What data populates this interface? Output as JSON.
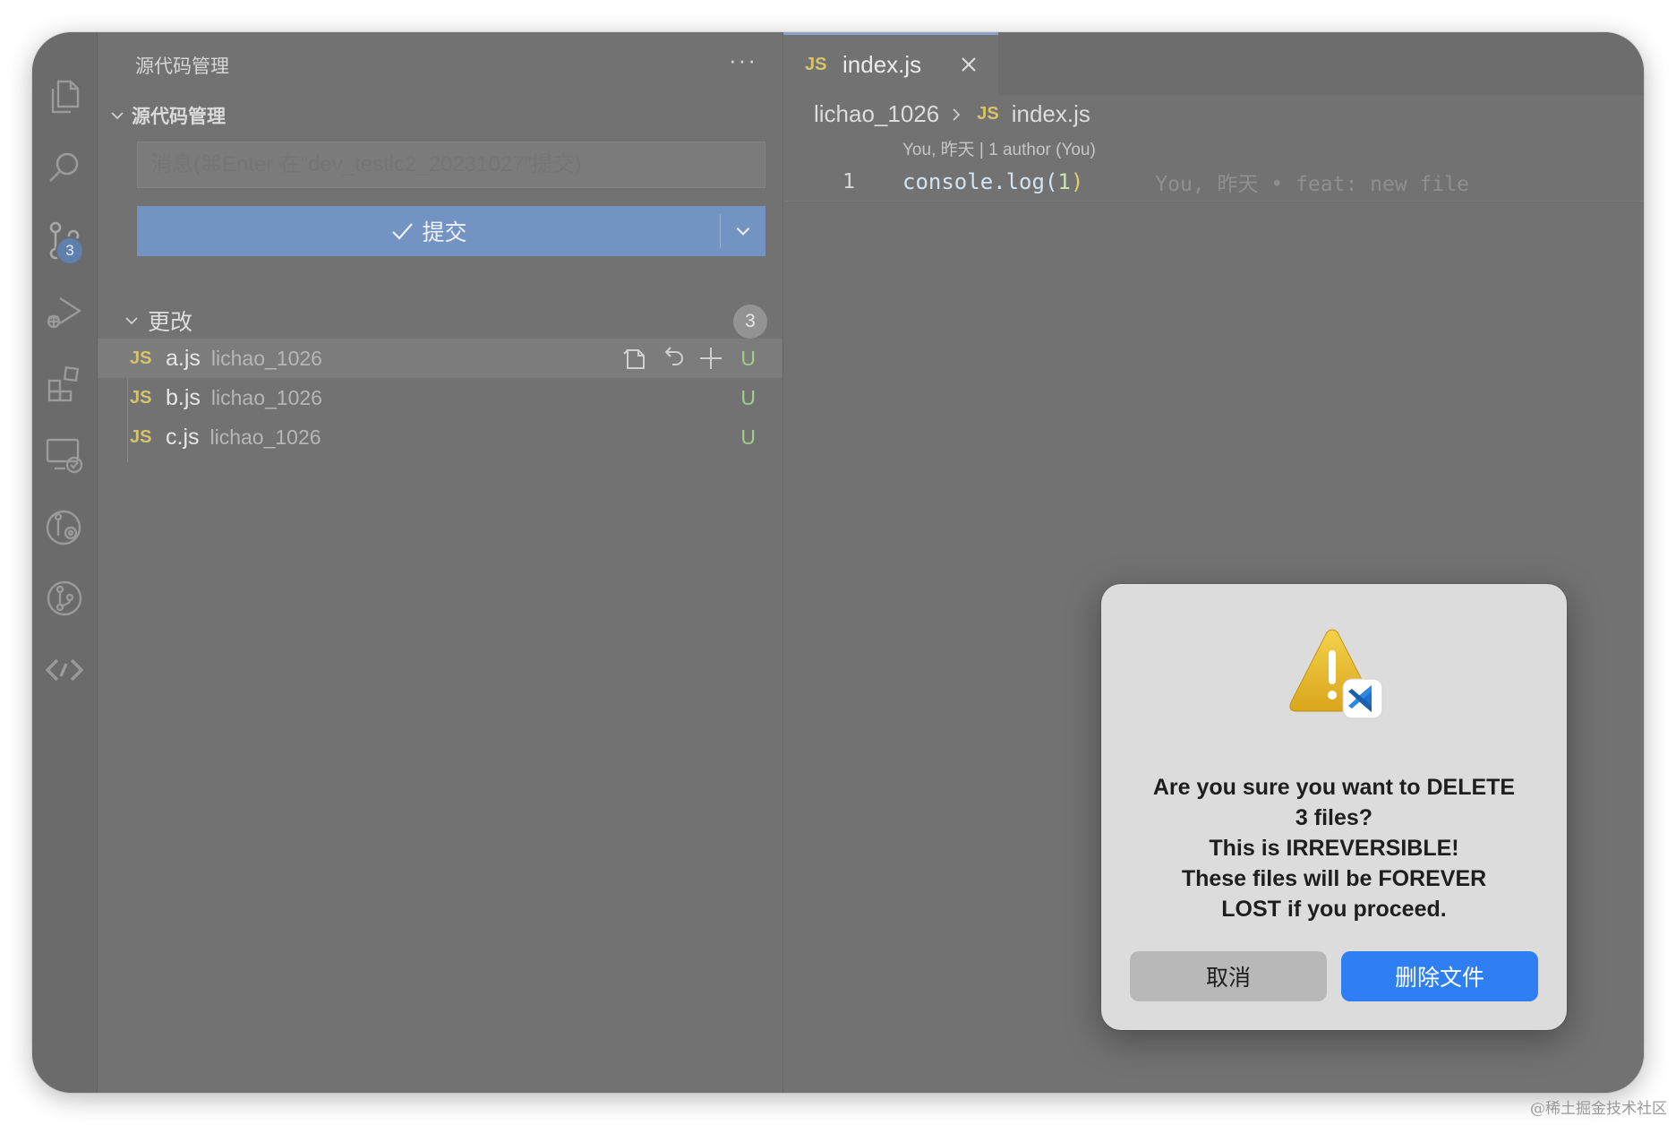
{
  "sidebar": {
    "title": "源代码管理",
    "more": "···",
    "section_title": "源代码管理",
    "commit_placeholder": "消息(⌘Enter 在“dev_testlc2_20231027”提交)",
    "commit_label": "提交",
    "changes_label": "更改",
    "changes_count": "3",
    "files": [
      {
        "icon": "JS",
        "name": "a.js",
        "path": "lichao_1026",
        "status": "U"
      },
      {
        "icon": "JS",
        "name": "b.js",
        "path": "lichao_1026",
        "status": "U"
      },
      {
        "icon": "JS",
        "name": "c.js",
        "path": "lichao_1026",
        "status": "U"
      }
    ]
  },
  "activity_bar": {
    "scm_badge": "3",
    "icons": [
      "files-icon",
      "search-icon",
      "source-control-icon",
      "run-debug-icon",
      "extensions-icon",
      "remote-explorer-icon",
      "timeline-icon",
      "git-graph-icon",
      "live-share-icon"
    ]
  },
  "editor": {
    "tab_icon": "JS",
    "tab_label": "index.js",
    "breadcrumb_folder": "lichao_1026",
    "breadcrumb_icon": "JS",
    "breadcrumb_file": "index.js",
    "blame_header": "You, 昨天 | 1 author (You)",
    "line_number": "1",
    "code_fn": "console.log(",
    "code_num": "1",
    "code_close": ")",
    "inline_blame": "You, 昨天 • feat: new file"
  },
  "dialog": {
    "message": "Are you sure you want to DELETE\n3 files?\nThis is IRREVERSIBLE!\nThese files will be FOREVER\nLOST if you proceed.",
    "cancel_label": "取消",
    "delete_label": "删除文件"
  },
  "colors": {
    "commit_button": "#7394c2",
    "delete_button": "#2d7ff3",
    "untracked": "#9fcf8a",
    "js_icon": "#d6c36a"
  },
  "watermark": "@稀土掘金技术社区"
}
